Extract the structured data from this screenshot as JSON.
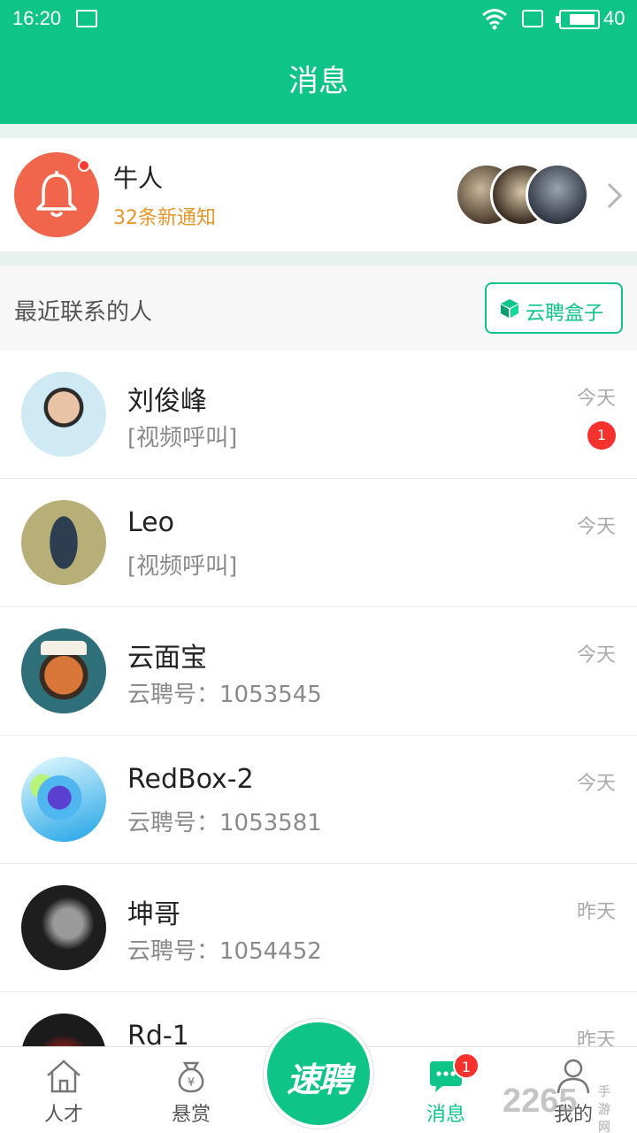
{
  "status_bar": {
    "time": "16:20",
    "battery": "40"
  },
  "header": {
    "title": "消息"
  },
  "notification": {
    "name": "牛人",
    "count_text": "32条新通知"
  },
  "section": {
    "label": "最近联系的人",
    "box_button": "云聘盒子"
  },
  "contacts": [
    {
      "name": "刘俊峰",
      "message": "[视频呼叫]",
      "time": "今天",
      "badge": "1"
    },
    {
      "name": "Leo",
      "message": "[视频呼叫]",
      "time": "今天",
      "badge": ""
    },
    {
      "name": "云面宝",
      "message": "云聘号：1053545",
      "time": "今天",
      "badge": ""
    },
    {
      "name": "RedBox-2",
      "message": "云聘号：1053581",
      "time": "今天",
      "badge": ""
    },
    {
      "name": "坤哥",
      "message": "云聘号：1054452",
      "time": "昨天",
      "badge": ""
    },
    {
      "name": "Rd-1",
      "message": "",
      "time": "昨天",
      "badge": ""
    }
  ],
  "tabbar": {
    "talent": "人才",
    "reward": "悬赏",
    "center": "速聘",
    "messages": "消息",
    "messages_badge": "1",
    "mine": "我的"
  },
  "watermark": {
    "text": "2265",
    "suffix": "手游网"
  },
  "colors": {
    "brand": "#0fc487",
    "bell": "#f0654b",
    "badge": "#f5322d",
    "highlight": "#e6962c"
  }
}
